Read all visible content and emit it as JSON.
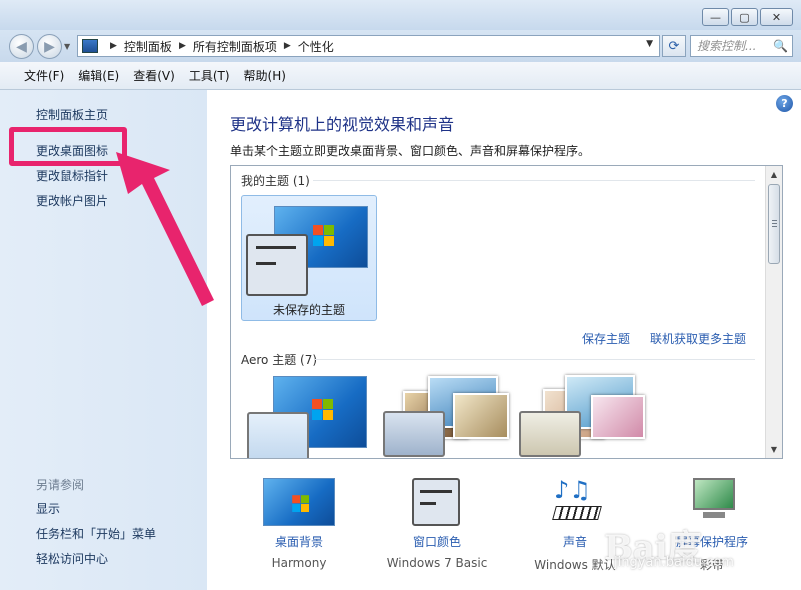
{
  "window": {
    "minimize": "—",
    "maximize": "▢",
    "close": "✕"
  },
  "nav": {
    "breadcrumbs": [
      "控制面板",
      "所有控制面板项",
      "个性化"
    ],
    "search_placeholder": "搜索控制...",
    "refresh_glyph": "⟳"
  },
  "menu": [
    "文件(F)",
    "编辑(E)",
    "查看(V)",
    "工具(T)",
    "帮助(H)"
  ],
  "sidebar": {
    "items": [
      "控制面板主页",
      "更改桌面图标",
      "更改鼠标指针",
      "更改帐户图片"
    ],
    "see_also_label": "另请参阅",
    "see_also": [
      "显示",
      "任务栏和「开始」菜单",
      "轻松访问中心"
    ],
    "highlight_color": "#e8246d"
  },
  "main": {
    "title": "更改计算机上的视觉效果和声音",
    "subtitle": "单击某个主题立即更改桌面背景、窗口颜色、声音和屏幕保护程序。",
    "my_themes_label": "我的主题 (1)",
    "unsaved_theme": "未保存的主题",
    "save_theme": "保存主题",
    "get_more_themes": "联机获取更多主题",
    "aero_label": "Aero 主题 (7)"
  },
  "bottom": [
    {
      "label": "桌面背景",
      "value": "Harmony"
    },
    {
      "label": "窗口颜色",
      "value": "Windows 7 Basic"
    },
    {
      "label": "声音",
      "value": "Windows 默认"
    },
    {
      "label": "屏幕保护程序",
      "value": "彩带"
    }
  ],
  "watermark": {
    "text": "Bai度",
    "sub": "jingyan.baidu.com"
  },
  "colors": {
    "accent_link": "#2a5db0",
    "title_blue": "#1e3287",
    "sidebar_bg": "#dae7f5"
  }
}
